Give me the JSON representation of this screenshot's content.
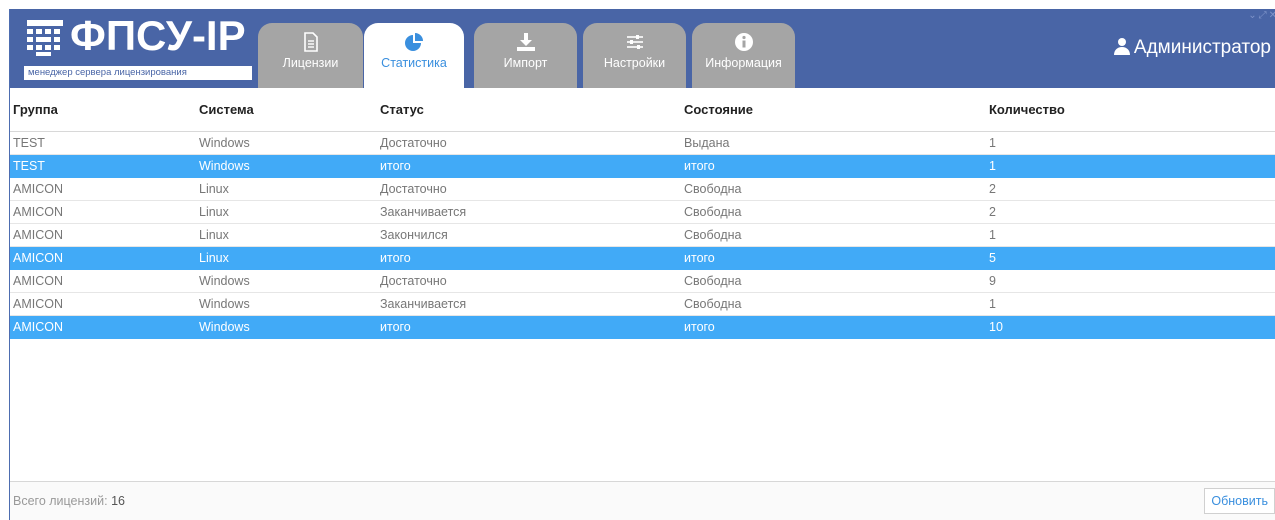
{
  "app": {
    "title": "ФПСУ-IP",
    "subtitle": "менеджер сервера лицензирования",
    "user": "Администратор"
  },
  "tabs": [
    {
      "label": "Лицензии",
      "icon": "document-icon",
      "active": false
    },
    {
      "label": "Статистика",
      "icon": "pie-chart-icon",
      "active": true
    },
    {
      "label": "Импорт",
      "icon": "download-icon",
      "active": false
    },
    {
      "label": "Настройки",
      "icon": "sliders-icon",
      "active": false
    },
    {
      "label": "Информация",
      "icon": "info-icon",
      "active": false
    }
  ],
  "table": {
    "columns": [
      "Группа",
      "Система",
      "Статус",
      "Состояние",
      "Количество"
    ],
    "rows": [
      {
        "cells": [
          "TEST",
          "Windows",
          "Достаточно",
          "Выдана",
          "1"
        ],
        "total": false
      },
      {
        "cells": [
          "TEST",
          "Windows",
          "итого",
          "итого",
          "1"
        ],
        "total": true
      },
      {
        "cells": [
          "AMICON",
          "Linux",
          "Достаточно",
          "Свободна",
          "2"
        ],
        "total": false
      },
      {
        "cells": [
          "AMICON",
          "Linux",
          "Заканчивается",
          "Свободна",
          "2"
        ],
        "total": false
      },
      {
        "cells": [
          "AMICON",
          "Linux",
          "Закончился",
          "Свободна",
          "1"
        ],
        "total": false
      },
      {
        "cells": [
          "AMICON",
          "Linux",
          "итого",
          "итого",
          "5"
        ],
        "total": true
      },
      {
        "cells": [
          "AMICON",
          "Windows",
          "Достаточно",
          "Свободна",
          "9"
        ],
        "total": false
      },
      {
        "cells": [
          "AMICON",
          "Windows",
          "Заканчивается",
          "Свободна",
          "1"
        ],
        "total": false
      },
      {
        "cells": [
          "AMICON",
          "Windows",
          "итого",
          "итого",
          "10"
        ],
        "total": true
      }
    ]
  },
  "footer": {
    "total_label": "Всего лицензий:",
    "total_value": "16",
    "refresh_label": "Обновить"
  },
  "colors": {
    "header": "#4965a6",
    "tab_inactive": "#a5a5a5",
    "accent": "#3a8fde",
    "row_highlight": "#41aaf7"
  }
}
